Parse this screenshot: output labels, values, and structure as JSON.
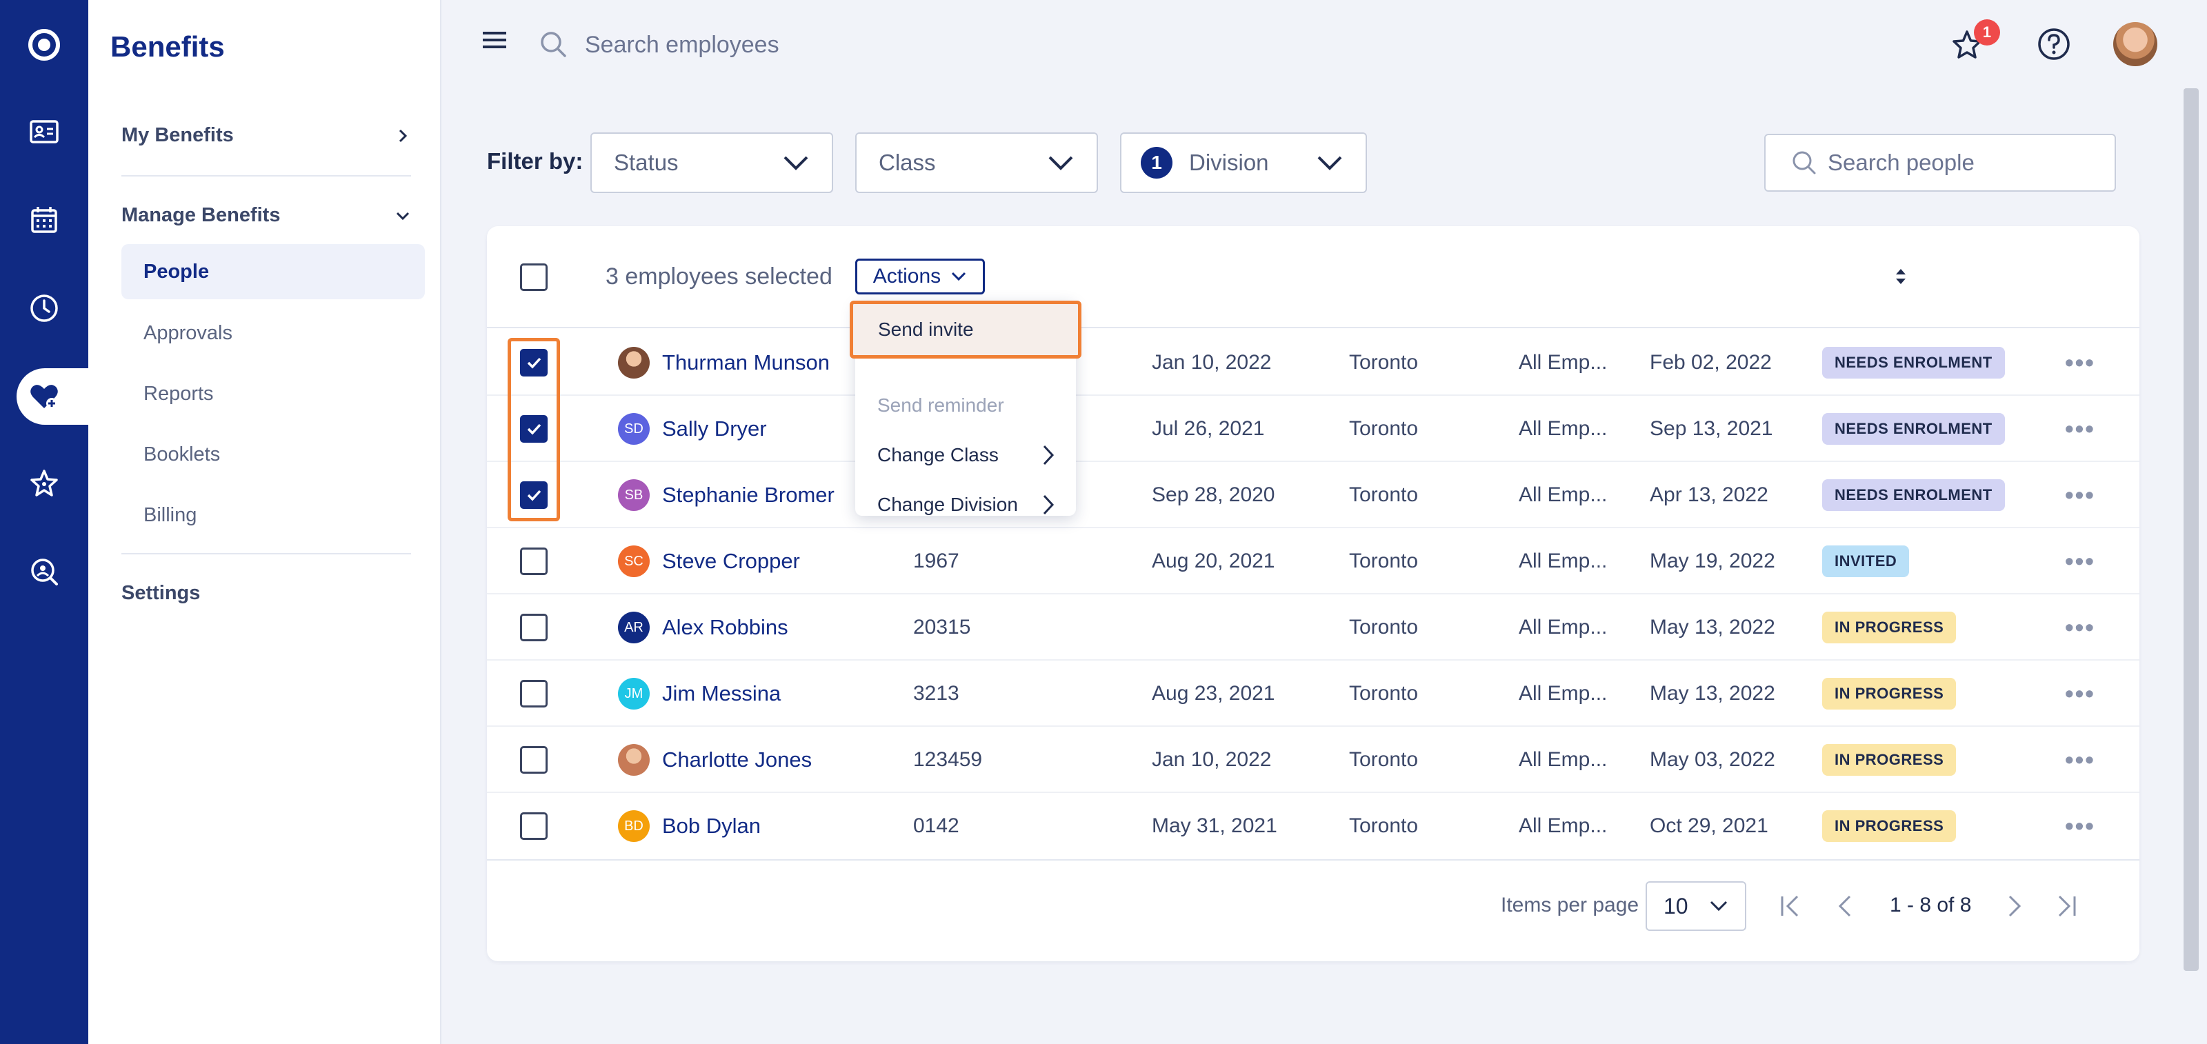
{
  "rail": {
    "items": [
      "logo",
      "employee-card",
      "calendar",
      "clock",
      "benefits",
      "star",
      "search-person"
    ]
  },
  "sidebar": {
    "brand": "Benefits",
    "my_benefits": "My Benefits",
    "manage_benefits": "Manage Benefits",
    "sub_items": [
      "People",
      "Approvals",
      "Reports",
      "Booklets",
      "Billing"
    ],
    "active_item": "People",
    "settings": "Settings"
  },
  "topbar": {
    "search_placeholder": "Search employees",
    "notification_count": "1"
  },
  "filters": {
    "label": "Filter by:",
    "status": "Status",
    "class": "Class",
    "division_count": "1",
    "division": "Division",
    "people_search_placeholder": "Search people"
  },
  "table": {
    "selected_text": "3 employees selected",
    "actions_label": "Actions",
    "rows": [
      {
        "name": "Thurman Munson",
        "initials": "",
        "avatar_color": "#7a4a34",
        "id": "",
        "hire_date": "Jan 10, 2022",
        "location": "Toronto",
        "class": "All Emp...",
        "updated": "Feb 02, 2022",
        "status": "NEEDS ENROLMENT",
        "status_color": "#d3d4f4",
        "checked": true
      },
      {
        "name": "Sally Dryer",
        "initials": "SD",
        "avatar_color": "#5b62e0",
        "id": "",
        "hire_date": "Jul 26, 2021",
        "location": "Toronto",
        "class": "All Emp...",
        "updated": "Sep 13, 2021",
        "status": "NEEDS ENROLMENT",
        "status_color": "#d3d4f4",
        "checked": true
      },
      {
        "name": "Stephanie Bromer",
        "initials": "SB",
        "avatar_color": "#a658b8",
        "id": "",
        "hire_date": "Sep 28, 2020",
        "location": "Toronto",
        "class": "All Emp...",
        "updated": "Apr 13, 2022",
        "status": "NEEDS ENROLMENT",
        "status_color": "#d3d4f4",
        "checked": true
      },
      {
        "name": "Steve Cropper",
        "initials": "SC",
        "avatar_color": "#f06a2c",
        "id": "1967",
        "hire_date": "Aug 20, 2021",
        "location": "Toronto",
        "class": "All Emp...",
        "updated": "May 19, 2022",
        "status": "INVITED",
        "status_color": "#b9e0f8",
        "checked": false
      },
      {
        "name": "Alex Robbins",
        "initials": "AR",
        "avatar_color": "#102a83",
        "id": "20315",
        "hire_date": "",
        "location": "Toronto",
        "class": "All Emp...",
        "updated": "May 13, 2022",
        "status": "IN PROGRESS",
        "status_color": "#fbe6a6",
        "checked": false
      },
      {
        "name": "Jim Messina",
        "initials": "JM",
        "avatar_color": "#1ec6e6",
        "id": "3213",
        "hire_date": "Aug 23, 2021",
        "location": "Toronto",
        "class": "All Emp...",
        "updated": "May 13, 2022",
        "status": "IN PROGRESS",
        "status_color": "#fbe6a6",
        "checked": false
      },
      {
        "name": "Charlotte Jones",
        "initials": "",
        "avatar_color": "#c77a56",
        "id": "123459",
        "hire_date": "Jan 10, 2022",
        "location": "Toronto",
        "class": "All Emp...",
        "updated": "May 03, 2022",
        "status": "IN PROGRESS",
        "status_color": "#fbe6a6",
        "checked": false
      },
      {
        "name": "Bob Dylan",
        "initials": "BD",
        "avatar_color": "#f5a00a",
        "id": "0142",
        "hire_date": "May 31, 2021",
        "location": "Toronto",
        "class": "All Emp...",
        "updated": "Oct 29, 2021",
        "status": "IN PROGRESS",
        "status_color": "#fbe6a6",
        "checked": false
      }
    ]
  },
  "actions_menu": {
    "items": [
      "Send invite",
      "Send reminder",
      "Change Class",
      "Change Division"
    ],
    "disabled": [
      "Send reminder"
    ],
    "highlighted": "Send invite"
  },
  "pagination": {
    "items_per_page_label": "Items per page",
    "items_per_page": "10",
    "range": "1 - 8 of 8"
  },
  "colors": {
    "navy": "#102a83",
    "highlight": "#f07f34",
    "page_bg": "#f1f3f9"
  }
}
